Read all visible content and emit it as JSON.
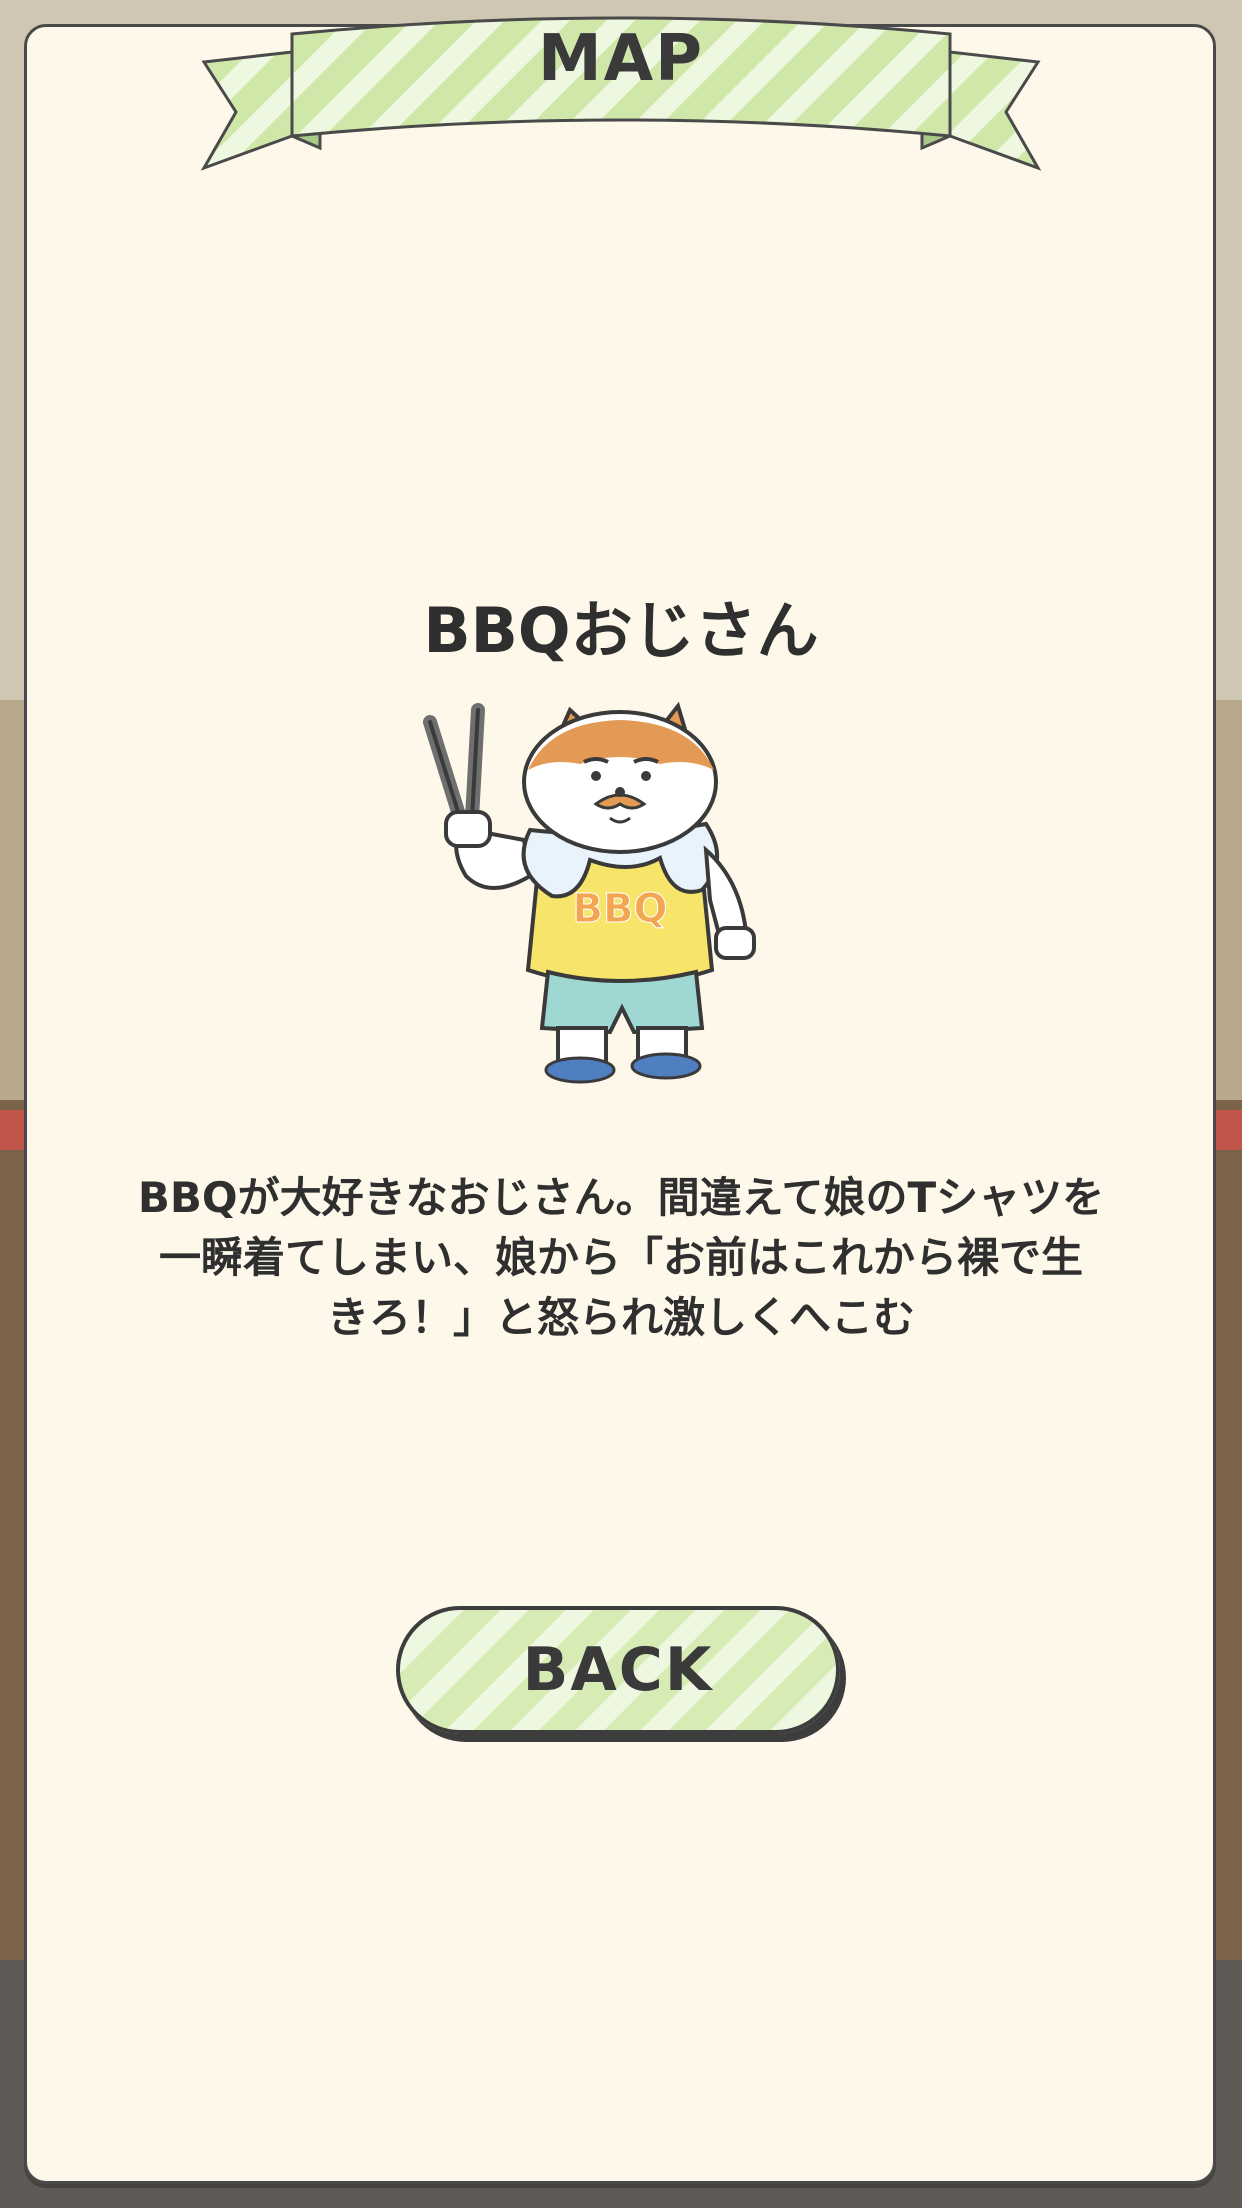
{
  "header": {
    "banner_label": "MAP"
  },
  "character": {
    "name": "BBQおじさん",
    "shirt_text": "BBQ",
    "description_lines": [
      "BBQが大好きなおじさん。間違えて娘のTシャツを",
      "一瞬着てしまい、娘から「お前はこれから裸で生",
      "きろ！」と怒られ激しくへこむ"
    ]
  },
  "actions": {
    "back_label": "BACK"
  },
  "colors": {
    "panel_bg": "#fdf8ea",
    "banner_green": "#d6ecb4",
    "outline": "#3d3d3d",
    "shirt_yellow": "#f7e46a",
    "shorts_teal": "#9fd8d2",
    "fur_orange": "#e39a55"
  }
}
